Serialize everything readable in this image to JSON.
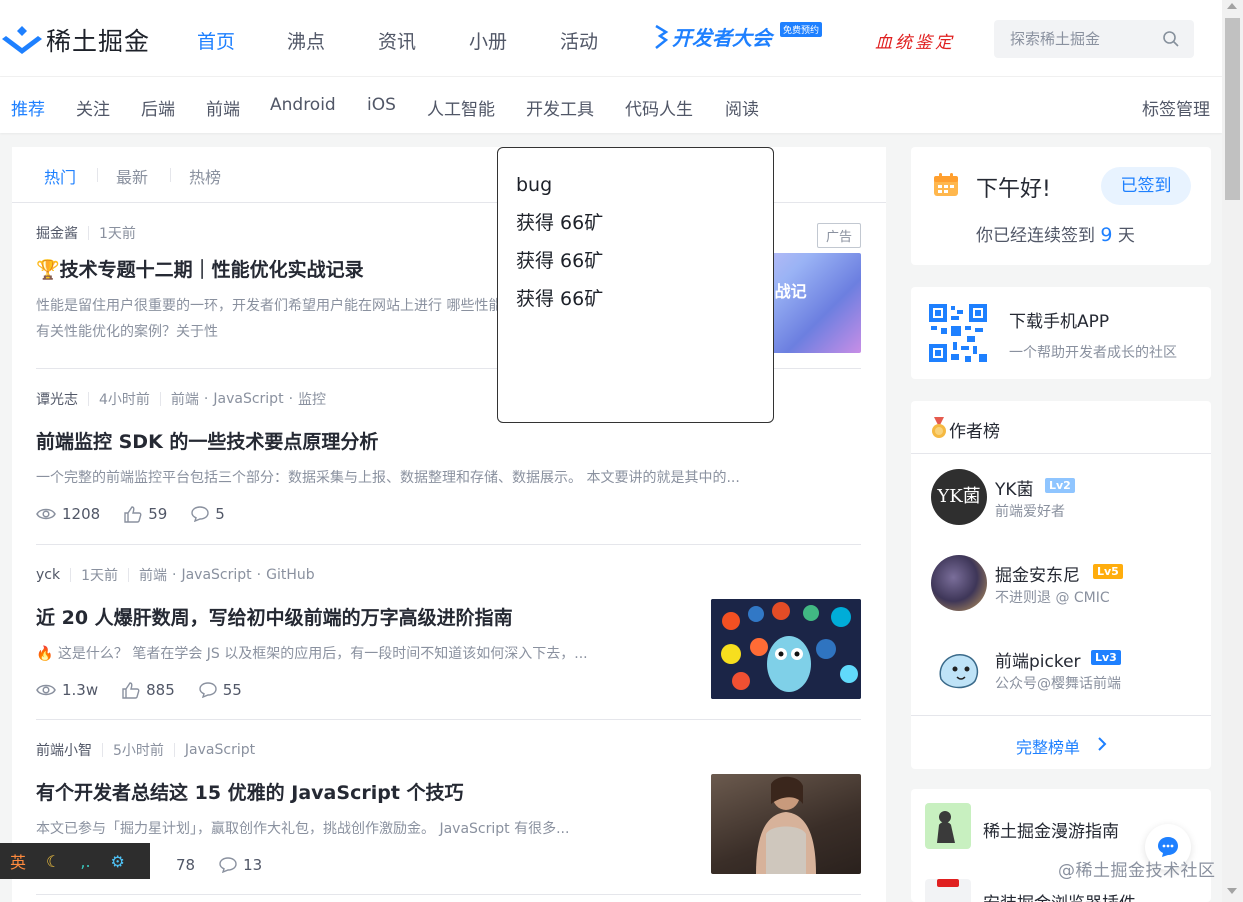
{
  "nav": {
    "logo_text": "稀土掘金",
    "items": [
      "首页",
      "沸点",
      "资讯",
      "小册",
      "活动"
    ],
    "conference_text": "开发者大会",
    "conference_badge": "免费预约",
    "bloodline_text": "血统鉴定",
    "search_placeholder": "探索稀土掘金"
  },
  "subnav": {
    "items": [
      "推荐",
      "关注",
      "后端",
      "前端",
      "Android",
      "iOS",
      "人工智能",
      "开发工具",
      "代码人生",
      "阅读"
    ],
    "manage_label": "标签管理"
  },
  "feed": {
    "tabs": [
      "热门",
      "最新",
      "热榜"
    ],
    "articles": [
      {
        "author": "掘金酱",
        "time": "1天前",
        "tags": [],
        "title": "🏆技术专题十二期｜性能优化实战记录",
        "excerpt": "性能是留住用户很重要的一环，开发者们希望用户能在网站上进行 哪些性能优化的项目呢？研究过哪些有关性能优化的案例？关于性",
        "ad_label": "广告",
        "thumb_text": "优化 实战记录"
      },
      {
        "author": "谭光志",
        "time": "4小时前",
        "tags": [
          "前端",
          "JavaScript",
          "监控"
        ],
        "title": "前端监控 SDK 的一些技术要点原理分析",
        "excerpt": "一个完整的前端监控平台包括三个部分：数据采集与上报、数据整理和存储、数据展示。 本文要讲的就是其中的...",
        "views": "1208",
        "likes": "59",
        "comments": "5"
      },
      {
        "author": "yck",
        "time": "1天前",
        "tags": [
          "前端",
          "JavaScript",
          "GitHub"
        ],
        "title": "近 20 人爆肝数周，写给初中级前端的万字高级进阶指南",
        "excerpt": "🔥 这是什么？ 笔者在学会 JS 以及框架的应用后，有一段时间不知道该如何深入下去，...",
        "views": "1.3w",
        "likes": "885",
        "comments": "55"
      },
      {
        "author": "前端小智",
        "time": "5小时前",
        "tags": [
          "JavaScript"
        ],
        "title": "有个开发者总结这 15 优雅的 JavaScript 个技巧",
        "excerpt": "本文已参与「掘力星计划」，赢取创作大礼包，挑战创作激励金。 JavaScript 有很多...",
        "likes": "78",
        "comments": "13"
      }
    ]
  },
  "signin": {
    "greeting": "下午好!",
    "button": "已签到",
    "streak_prefix": "你已经连续签到",
    "streak_days": "9",
    "streak_suffix": "天"
  },
  "app_download": {
    "title": "下载手机APP",
    "subtitle": "一个帮助开发者成长的社区"
  },
  "authors": {
    "title": "作者榜",
    "list": [
      {
        "name": "YK菌",
        "level": "Lv2",
        "bio": "前端爱好者",
        "avatar_text": "YK菌"
      },
      {
        "name": "掘金安东尼",
        "level": "Lv5",
        "bio": "不进则退 @ CMIC"
      },
      {
        "name": "前端picker",
        "level": "Lv3",
        "bio": "公众号@樱舞话前端"
      }
    ],
    "more_label": "完整榜单"
  },
  "guides": [
    "稀土掘金漫游指南",
    "安装掘金浏览器插件"
  ],
  "popup": {
    "lines": [
      "bug",
      "获得 66矿",
      "获得 66矿",
      "获得 66矿"
    ]
  },
  "ime": {
    "lang": "英"
  },
  "watermark": "@稀土掘金技术社区",
  "colors": {
    "accent": "#1e80ff",
    "text": "#252933",
    "muted": "#8a919f"
  }
}
